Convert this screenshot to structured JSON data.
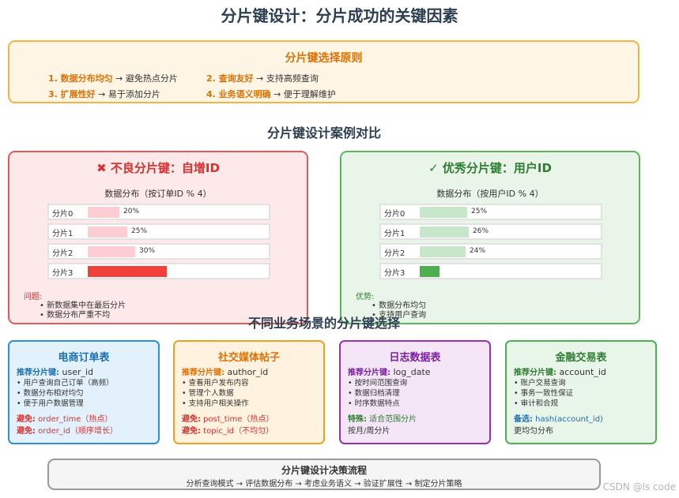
{
  "title": "分片键设计：分片成功的关键因素",
  "principles": {
    "title": "分片键选择原则",
    "items": [
      {
        "key": "1. 数据分布均匀",
        "desc": " → 避免热点分片"
      },
      {
        "key": "2. 查询友好",
        "desc": " → 支持高频查询"
      },
      {
        "key": "3. 扩展性好",
        "desc": " → 易于添加分片"
      },
      {
        "key": "4. 业务语义明确",
        "desc": " → 便于理解维护"
      }
    ]
  },
  "case_title": "分片键设计案例对比",
  "bad_case": {
    "icon": "✖",
    "title": "不良分片键：自增ID",
    "dist_title": "数据分布（按订单ID % 4）",
    "rows": [
      {
        "label": "分片0",
        "value": 20,
        "text": "20%"
      },
      {
        "label": "分片1",
        "value": 25,
        "text": "25%"
      },
      {
        "label": "分片2",
        "value": 30,
        "text": "30%"
      },
      {
        "label": "分片3",
        "value": 100,
        "text": ""
      }
    ],
    "fill_color": "#fccdd2",
    "hot_color": "#f0413b",
    "notes_header": "问题:",
    "notes": [
      "新数据集中在最后分片",
      "数据分布严重不均"
    ]
  },
  "good_case": {
    "icon": "✓",
    "title": "优秀分片键：用户ID",
    "dist_title": "数据分布（按用户ID % 4）",
    "rows": [
      {
        "label": "分片0",
        "value": 25,
        "text": "25%"
      },
      {
        "label": "分片1",
        "value": 26,
        "text": "26%"
      },
      {
        "label": "分片2",
        "value": 24,
        "text": "24%"
      },
      {
        "label": "分片3",
        "value": 25,
        "text": ""
      }
    ],
    "fill_color": "#c8e6c9",
    "hot_color": "#4caf50",
    "notes_header": "优势:",
    "notes": [
      "数据分布均匀",
      "支持用户查询"
    ]
  },
  "scenario_title": "不同业务场景的分片键选择",
  "scenarios": [
    {
      "title": "电商订单表",
      "rec_key": "推荐分片键:",
      "rec_val": " user_id",
      "items": [
        "用户查询自己订单（高频）",
        "数据分布相对均匀",
        "便于用户数据管理"
      ],
      "avoid": [
        {
          "k": "避免:",
          "v": " order_time（热点）"
        },
        {
          "k": "避免:",
          "v": " order_id（顺序增长）"
        }
      ]
    },
    {
      "title": "社交媒体帖子",
      "rec_key": "推荐分片键:",
      "rec_val": " author_id",
      "items": [
        "查看用户发布内容",
        "管理个人数据",
        "支持用户相关操作"
      ],
      "avoid": [
        {
          "k": "避免:",
          "v": " post_time（热点）"
        },
        {
          "k": "避免:",
          "v": " topic_id（不均匀）"
        }
      ]
    },
    {
      "title": "日志数据表",
      "rec_key": "推荐分片键:",
      "rec_val": " log_date",
      "items": [
        "按时间范围查询",
        "数据归档清理",
        "时序数据特点"
      ],
      "extra_key": "特殊:",
      "extra_val": " 适合范围分片",
      "extra_line2": "按月/周分片"
    },
    {
      "title": "金融交易表",
      "rec_key": "推荐分片键:",
      "rec_val": " account_id",
      "items": [
        "账户交易查询",
        "事务一致性保证",
        "审计和合规"
      ],
      "extra_key": "备选:",
      "extra_val": " hash(account_id)",
      "extra_line2": "更均匀分布"
    }
  ],
  "flow": {
    "title": "分片键设计决策流程",
    "steps": "分析查询模式 → 评估数据分布 → 考虑业务语义 → 验证扩展性 → 制定分片策略"
  },
  "watermark": "CSDN @ls code",
  "colors": {
    "ecommerce": "#2d8fd5",
    "social": "#f0a020",
    "log": "#9b30b0",
    "finance": "#4caf50"
  }
}
